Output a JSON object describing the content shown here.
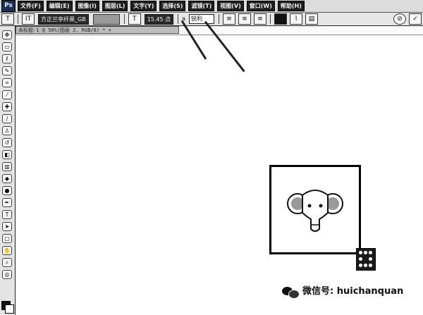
{
  "app": {
    "logo": "Ps"
  },
  "menu": {
    "items": [
      {
        "label": "文件(F)"
      },
      {
        "label": "编辑(E)"
      },
      {
        "label": "图像(I)"
      },
      {
        "label": "图层(L)"
      },
      {
        "label": "文字(Y)"
      },
      {
        "label": "选择(S)"
      },
      {
        "label": "滤镜(T)"
      },
      {
        "label": "视图(V)"
      },
      {
        "label": "窗口(W)"
      },
      {
        "label": "帮助(H)"
      }
    ]
  },
  "options": {
    "orientation_icon": "IT",
    "font_family": "方正兰亭纤黑_GB",
    "font_size": "15.45 点",
    "anti_alias": "锐利",
    "align_icons": [
      "align-left-icon",
      "align-center-icon",
      "align-right-icon"
    ],
    "right_icons": [
      "cancel-icon",
      "commit-icon"
    ]
  },
  "document": {
    "tab_title": "未标题-1 @ 50%(图层 2, RGB/8) * ×"
  },
  "tools": {
    "icons": [
      "move-icon",
      "marquee-icon",
      "lasso-icon",
      "quick-select-icon",
      "crop-icon",
      "eyedropper-icon",
      "healing-icon",
      "brush-icon",
      "stamp-icon",
      "history-brush-icon",
      "eraser-icon",
      "gradient-icon",
      "blur-icon",
      "dodge-icon",
      "pen-icon",
      "type-icon",
      "path-select-icon",
      "shape-icon",
      "hand-icon",
      "zoom-icon",
      "quick-mask-icon"
    ]
  },
  "watermark": {
    "text": "微信号: huichanquan"
  }
}
